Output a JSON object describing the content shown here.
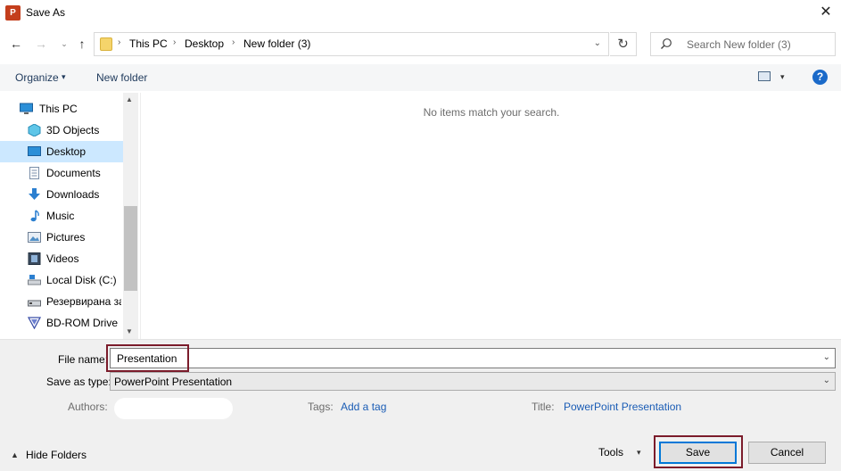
{
  "window": {
    "title": "Save As",
    "app_icon_text": "P",
    "close_glyph": "✕"
  },
  "nav": {
    "back_glyph": "←",
    "forward_glyph": "→",
    "recent_glyph": "⌄",
    "up_glyph": "↑"
  },
  "address": {
    "crumbs": [
      "This PC",
      "Desktop",
      "New folder (3)"
    ],
    "separator": "›",
    "dropdown_glyph": "⌄",
    "refresh_glyph": "↻"
  },
  "search": {
    "placeholder": "Search New folder (3)",
    "icon": "search-icon"
  },
  "toolbar": {
    "organize_label": "Organize",
    "caret": "▾",
    "new_folder_label": "New folder",
    "help_glyph": "?"
  },
  "sidebar": {
    "items": [
      {
        "label": "This PC",
        "icon": "computer-icon",
        "selected": false
      },
      {
        "label": "3D Objects",
        "icon": "cube-icon",
        "selected": false
      },
      {
        "label": "Desktop",
        "icon": "desktop-icon",
        "selected": true
      },
      {
        "label": "Documents",
        "icon": "documents-icon",
        "selected": false
      },
      {
        "label": "Downloads",
        "icon": "download-icon",
        "selected": false
      },
      {
        "label": "Music",
        "icon": "music-icon",
        "selected": false
      },
      {
        "label": "Pictures",
        "icon": "pictures-icon",
        "selected": false
      },
      {
        "label": "Videos",
        "icon": "videos-icon",
        "selected": false
      },
      {
        "label": "Local Disk (C:)",
        "icon": "disk-icon",
        "selected": false
      },
      {
        "label": "Резервирана за",
        "icon": "drive-icon",
        "selected": false
      },
      {
        "label": "BD-ROM Drive (I",
        "icon": "bd-rom-icon",
        "selected": false
      }
    ],
    "scroll_up_glyph": "▲",
    "scroll_down_glyph": "▼"
  },
  "content": {
    "empty_message": "No items match your search."
  },
  "form": {
    "file_name_label": "File name:",
    "file_name_value": "Presentation",
    "save_type_label": "Save as type:",
    "save_type_value": "PowerPoint Presentation",
    "dropdown_glyph": "⌄",
    "authors_label": "Authors:",
    "tags_label": "Tags:",
    "tags_link": "Add a tag",
    "title_label": "Title:",
    "title_link": "PowerPoint Presentation"
  },
  "footer": {
    "hide_folders_glyph": "▲",
    "hide_folders_label": "Hide Folders",
    "tools_label": "Tools",
    "tools_caret": "▾",
    "save_label": "Save",
    "cancel_label": "Cancel"
  },
  "colors": {
    "accent": "#0078d7",
    "highlight_border": "#7b1c2b",
    "selected_bg": "#cce8ff",
    "link": "#1a5cb5"
  }
}
